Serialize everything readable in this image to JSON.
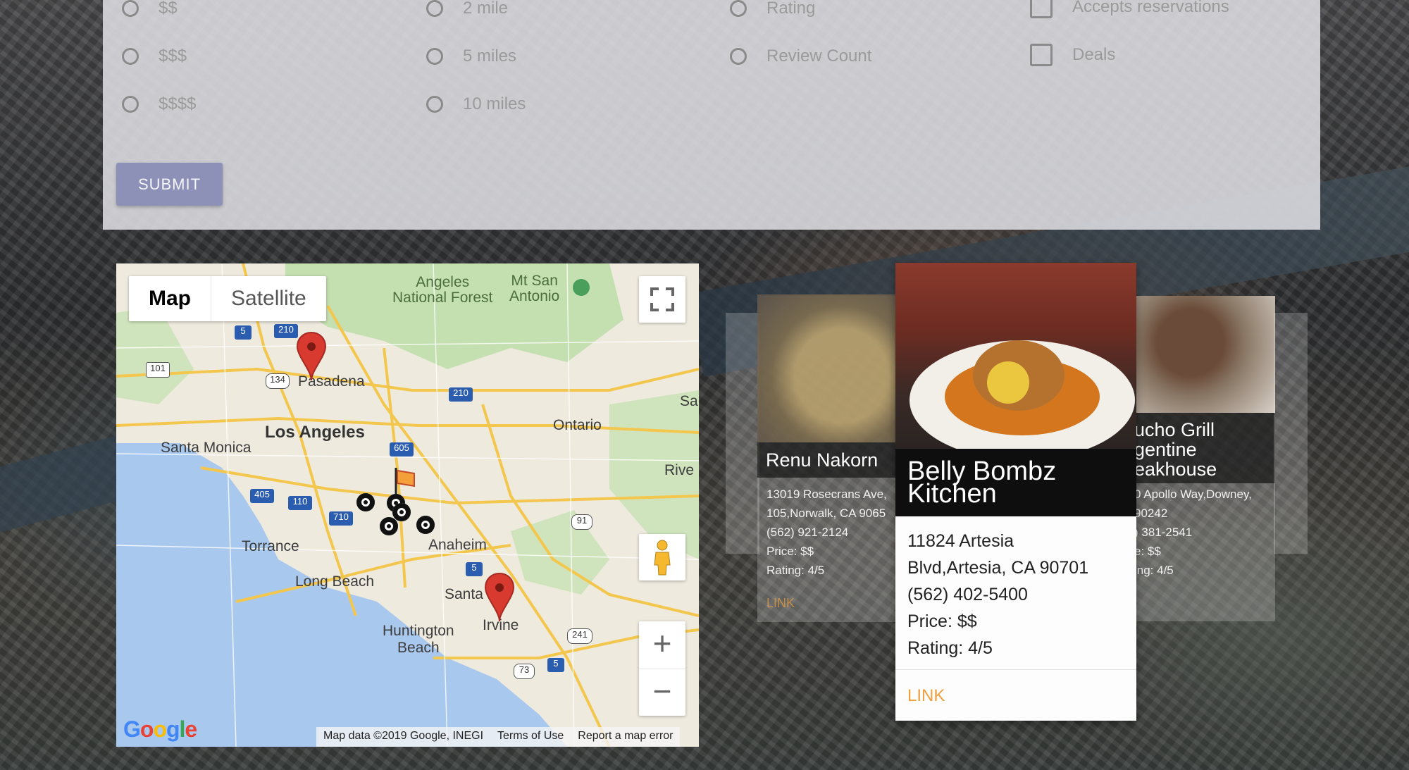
{
  "filters": {
    "price": [
      "$$",
      "$$$",
      "$$$$"
    ],
    "distance": [
      "2 mile",
      "5 miles",
      "10 miles"
    ],
    "sort": [
      "Rating",
      "Review Count"
    ],
    "features": [
      "Accepts reservations",
      "Deals"
    ],
    "submit_label": "SUBMIT"
  },
  "map": {
    "type_map": "Map",
    "type_satellite": "Satellite",
    "zoom_in": "+",
    "zoom_out": "−",
    "labels": {
      "angeles_nf": "Angeles\nNational Forest",
      "mt_san_antonio": "Mt San\nAntonio",
      "pasadena": "Pasadena",
      "los_angeles": "Los Angeles",
      "santa_monica": "Santa Monica",
      "ontario": "Ontario",
      "riverside": "Rive",
      "torrance": "Torrance",
      "anaheim": "Anaheim",
      "long_beach": "Long Beach",
      "santa_ana": "Santa",
      "huntington_beach": "Huntington\nBeach",
      "irvine": "Irvine",
      "sa": "Sa"
    },
    "shields": [
      "5",
      "210",
      "101",
      "134",
      "210",
      "605",
      "405",
      "110",
      "710",
      "91",
      "5",
      "241",
      "73",
      "5"
    ],
    "google": "Google",
    "attribution": "Map data ©2019 Google, INEGI",
    "terms": "Terms of Use",
    "report": "Report a map error"
  },
  "cards": [
    {
      "name": "Renu Nakorn",
      "address": "13019 Rosecrans Ave, 105,Norwalk, CA 9065",
      "address_line1": "13019 Rosecrans Ave,",
      "address_line2": "105,Norwalk, CA 9065",
      "phone": "(562) 921-2124",
      "price": "Price: $$",
      "rating": "Rating: 4/5",
      "link": "LINK"
    },
    {
      "name": "Belly Bombz Kitchen",
      "name_line1": "Belly Bombz",
      "name_line2": "Kitchen",
      "address_line1": "11824 Artesia",
      "address_line2": "Blvd,Artesia, CA 90701",
      "phone": "(562) 402-5400",
      "price": "Price: $$",
      "rating": "Rating: 4/5",
      "link": "LINK"
    },
    {
      "name_line1": "ucho Grill",
      "name_line2": "gentine",
      "name_line3": "eakhouse",
      "address_line1": "0 Apollo Way,Downey,",
      "address_line2": "90242",
      "phone": ") 381-2541",
      "price": "e: $$",
      "rating": "ing: 4/5"
    }
  ],
  "colors": {
    "accent_link": "#ef9f3d",
    "submit": "#8d91b8",
    "marker_red": "#d93a2f"
  }
}
